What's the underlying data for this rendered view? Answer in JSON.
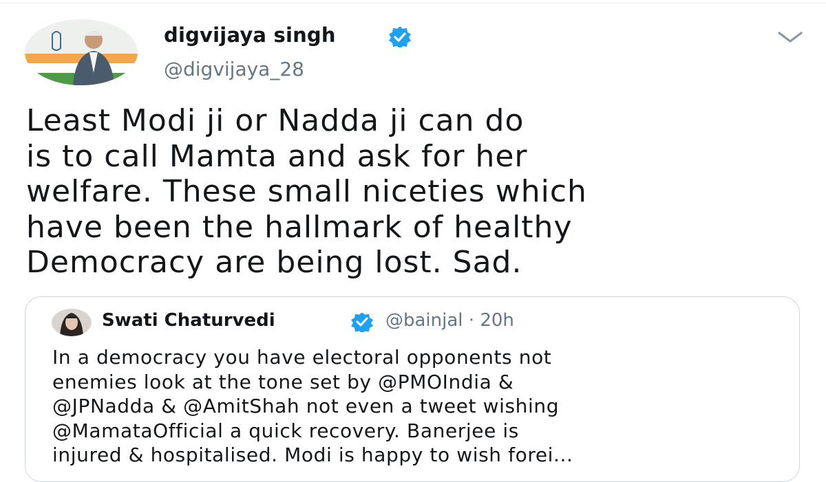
{
  "tweet": {
    "author": {
      "name": "digvijaya singh",
      "handle": "@digvijaya_28",
      "verified": true,
      "avatar_icon": "avatar-photo-icon"
    },
    "text_lines": [
      "Least Modi ji or Nadda ji can do",
      "is to call Mamta and ask for her",
      "welfare. These small niceties which",
      "have been the hallmark of healthy",
      "Democracy are being lost. Sad."
    ],
    "menu_icon": "chevron-down-icon"
  },
  "quoted_tweet": {
    "author": {
      "name": "Swati Chaturvedi",
      "verified": true,
      "avatar_icon": "avatar-photo-icon"
    },
    "meta": "@bainjal · 20h",
    "text_lines": [
      "In a democracy you have electoral opponents not",
      "enemies look at the tone set by @PMOIndia &",
      "@JPNadda & @AmitShah not even a tweet wishing",
      "@MamataOfficial a quick recovery. Banerjee is",
      "injured & hospitalised. Modi is happy to wish forei..."
    ]
  },
  "colors": {
    "verified": "#1da1f2",
    "secondary_text": "#657786",
    "primary_text": "#14171a",
    "border": "#ccd6dd"
  }
}
